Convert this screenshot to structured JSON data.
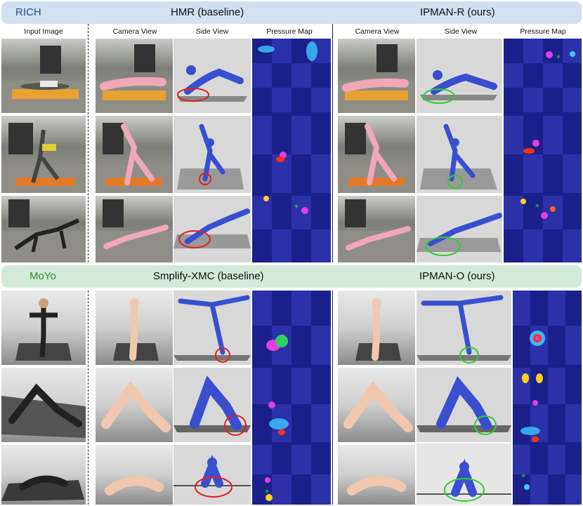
{
  "top_section": {
    "dataset": "RICH",
    "baseline_title": "HMR (baseline)",
    "ours_title": "IPMAN-R (ours)",
    "dataset_color": "#1f4e9a"
  },
  "bottom_section": {
    "dataset": "MoYo",
    "baseline_title": "Smplify-XMC (baseline)",
    "ours_title": "IPMAN-O (ours)",
    "dataset_color": "#3a8a2a"
  },
  "column_headers": {
    "input": "Input Image",
    "camera": "Camera View",
    "side": "Side View",
    "pressure": "Pressure Map"
  },
  "colors": {
    "baseline_circle": "#e02020",
    "ours_circle": "#33cc33",
    "body_mesh": "#3a4fd0",
    "camera_overlay": "#f0a8b8"
  }
}
